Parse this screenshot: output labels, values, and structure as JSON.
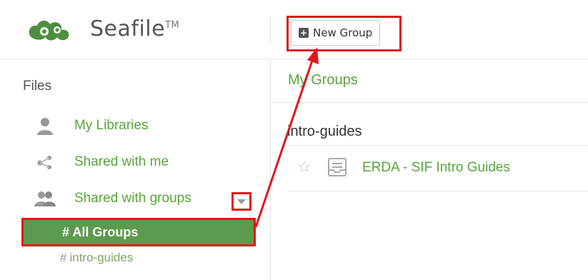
{
  "header": {
    "logo_text": "Seafile",
    "logo_trademark": "TM",
    "new_group_label": "New Group"
  },
  "sidebar": {
    "heading": "Files",
    "items": [
      {
        "label": "My Libraries",
        "icon": "user-icon"
      },
      {
        "label": "Shared with me",
        "icon": "share-icon"
      },
      {
        "label": "Shared with groups",
        "icon": "group-icon"
      }
    ],
    "all_groups_label": "# All Groups",
    "subgroups": [
      {
        "hash": "#",
        "label": "intro-guides"
      }
    ]
  },
  "main": {
    "title": "My Groups",
    "group_name": "intro-guides",
    "libraries": [
      {
        "name": "ERDA - SIF Intro Guides"
      }
    ]
  },
  "annotation": {
    "highlight_color": "#e0161c"
  },
  "colors": {
    "brand_green": "#57a639",
    "selected_bg": "#5c9a4d"
  }
}
